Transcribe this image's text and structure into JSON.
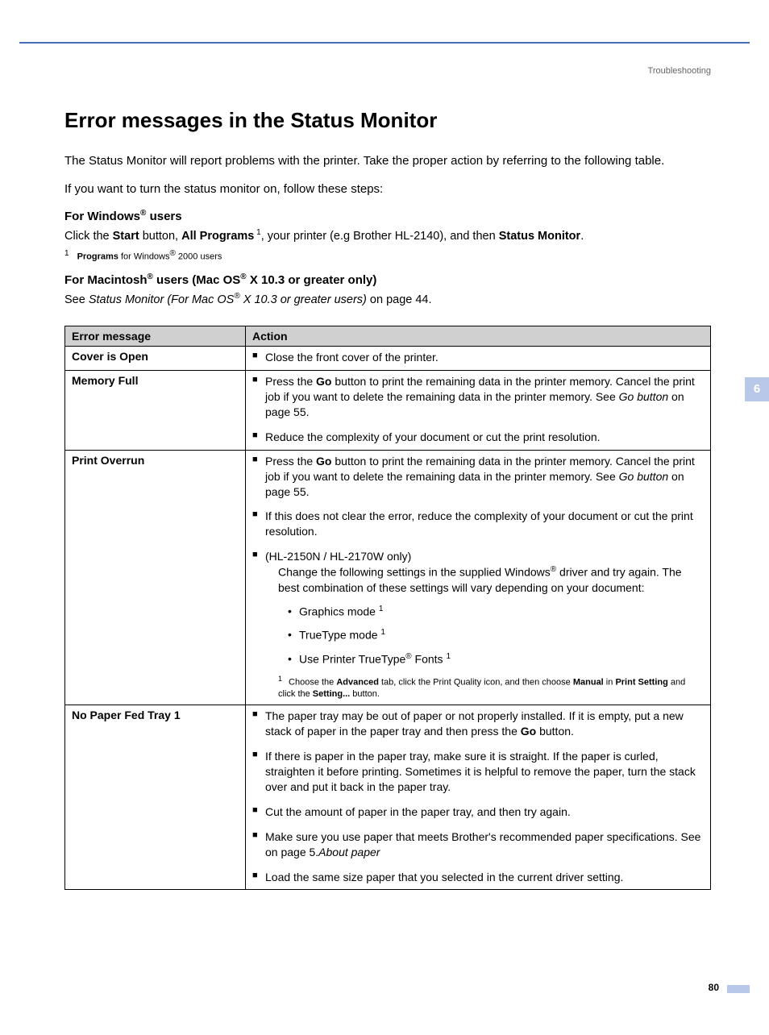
{
  "header_label": "Troubleshooting",
  "title": "Error messages in the Status Monitor",
  "intro1": "The Status Monitor will report problems with the printer. Take the proper action by referring to the following table.",
  "intro2": "If you want to turn the status monitor on, follow these steps:",
  "windows": {
    "heading_pre": "For Windows",
    "heading_post": " users",
    "line_parts": {
      "p1": "Click the ",
      "b1": "Start",
      "p2": " button, ",
      "b2": "All Programs",
      "sup": " 1",
      "p3": ", your printer (e.g Brother HL-2140), and then ",
      "b3": "Status Monitor",
      "p4": "."
    },
    "footnote_num": "1",
    "footnote_bold": "Programs",
    "footnote_rest_pre": " for Windows",
    "footnote_rest_post": " 2000 users"
  },
  "mac": {
    "heading_pre": "For Macintosh",
    "heading_mid": " users (Mac OS",
    "heading_post": " X 10.3 or greater only)",
    "see_pre": "See ",
    "see_italic_pre": "Status Monitor (For Mac OS",
    "see_italic_post": " X 10.3 or greater users)",
    "see_post": " on page 44."
  },
  "table": {
    "h1": "Error message",
    "h2": "Action",
    "rows": [
      {
        "name": "Cover is Open",
        "actions": [
          {
            "plain": "Close the front cover of the printer."
          }
        ]
      },
      {
        "name": "Memory Full",
        "actions": [
          {
            "parts": {
              "p1": "Press the ",
              "b1": "Go",
              "p2": " button to print the remaining data in the printer memory. Cancel the print job if you want to delete the remaining data in the printer memory. See ",
              "i1": "Go button",
              "p3": " on page 55."
            }
          },
          {
            "plain": "Reduce the complexity of your document or cut the print resolution."
          }
        ]
      },
      {
        "name": "Print Overrun",
        "actions": [
          {
            "parts": {
              "p1": "Press the ",
              "b1": "Go",
              "p2": " button to print the remaining data in the printer memory. Cancel the print job if you want to delete the remaining data in the printer memory. See ",
              "i1": "Go button",
              "p3": " on page 55."
            }
          },
          {
            "plain": "If this does not clear the error, reduce the complexity of your document or cut the print resolution."
          },
          {
            "plain": "(HL-2150N / HL-2170W only)",
            "sub_parts": {
              "p1": "Change the following settings in the supplied Windows",
              "sup1": "®",
              "p2": " driver and try again. The best combination of these settings will vary depending on your document:"
            },
            "dots": [
              {
                "t": "Graphics mode ",
                "sup": "1"
              },
              {
                "t": "TrueType mode ",
                "sup": "1"
              },
              {
                "t_pre": "Use Printer TrueType",
                "sup_mid": "®",
                "t_post": " Fonts ",
                "sup": "1"
              }
            ],
            "footnote": {
              "num": "1",
              "p1": "Choose the ",
              "b1": "Advanced",
              "p2": " tab, click the Print Quality icon, and then choose ",
              "b2": "Manual",
              "p3": " in ",
              "b3": "Print Setting",
              "p4": " and click the ",
              "b4": "Setting...",
              "p5": " button."
            }
          }
        ]
      },
      {
        "name": "No Paper Fed Tray 1",
        "actions": [
          {
            "parts": {
              "p1": "The paper tray may be out of paper or not properly installed. If it is empty, put a new stack of paper in the paper tray and then press the ",
              "b1": "Go",
              "p2": " button."
            }
          },
          {
            "plain": "If there is paper in the paper tray, make sure it is straight. If the paper is curled, straighten it before printing. Sometimes it is helpful to remove the paper, turn the stack over and put it back in the paper tray."
          },
          {
            "plain": "Cut the amount of paper in the paper tray, and then try again."
          },
          {
            "parts": {
              "p1": "Make sure you use paper that meets Brother's recommended paper specifications. See ",
              "i1": "About paper",
              "p2": " on page 5."
            }
          },
          {
            "plain": "Load the same size paper that you selected in the current driver setting."
          }
        ]
      }
    ]
  },
  "side_tab": "6",
  "page_num": "80"
}
